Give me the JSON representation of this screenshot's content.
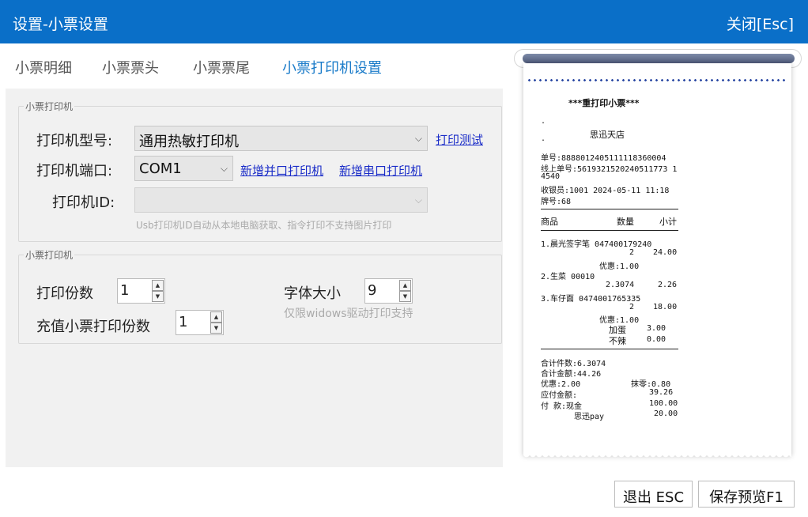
{
  "window": {
    "title": "设置-小票设置",
    "close_label": "关闭[Esc]"
  },
  "colors": {
    "titlebar": "#0a6fc8",
    "active_tab": "#1a7bc9",
    "link": "#1a2cc8"
  },
  "tabs": [
    {
      "label": "小票明细",
      "active": false
    },
    {
      "label": "小票票头",
      "active": false
    },
    {
      "label": "小票票尾",
      "active": false
    },
    {
      "label": "小票打印机设置",
      "active": true
    }
  ],
  "printer_group": {
    "legend": "小票打印机",
    "model_label": "打印机型号:",
    "model_value": "通用热敏打印机",
    "test_link": "打印测试",
    "port_label": "打印机端口:",
    "port_value": "COM1",
    "add_parallel_link": "新增并口打印机",
    "add_serial_link": "新增串口打印机",
    "id_label": "打印机ID:",
    "id_value": "",
    "id_hint": "Usb打印机ID自动从本地电脑获取、指令打印不支持图片打印"
  },
  "copies_group": {
    "legend": "小票打印机",
    "copies_label": "打印份数",
    "copies_value": "1",
    "font_size_label": "字体大小",
    "font_size_value": "9",
    "font_hint": "仅限widows驱动打印支持",
    "recharge_label": "充值小票打印份数",
    "recharge_value": "1"
  },
  "receipt": {
    "header": "***重打印小票***",
    "dot1": ".",
    "dot2": ".",
    "store": "思迅天店",
    "order_no": "单号:8888012405111118360004",
    "online_no_1": "线上单号:5619321520240511773 1",
    "online_no_2": "4540",
    "cashier": "收银员:1001 2024-05-11 11:18",
    "plate": "牌号:68",
    "col_item": "商品",
    "col_qty": "数量",
    "col_subtotal": "小计",
    "items": [
      {
        "name": "1.晨光签字笔 047400179240",
        "qty": "2",
        "amount": "24.00",
        "discount": "优惠:1.00"
      },
      {
        "name": "2.生菜 00010",
        "qty": "2.3074",
        "amount": "2.26"
      },
      {
        "name": "3.车仔面 0474001765335",
        "qty": "2",
        "amount": "18.00",
        "discount": "优惠:1.00",
        "addons": [
          {
            "name": "加蛋",
            "amount": "3.00"
          },
          {
            "name": "不辣",
            "amount": "0.00"
          }
        ]
      }
    ],
    "total_count": "合计件数:6.3074",
    "total_amount": "合计金额:44.26",
    "discount": "优惠:2.00",
    "round_off": "抹零:0.80",
    "payable_label": "应付金额:",
    "payable_value": "39.26",
    "pay_label": "付  款:现金",
    "pay_value": "100.00",
    "pay2_label": "思迅pay",
    "pay2_value": "20.00"
  },
  "footer": {
    "exit_label": "退出 ESC",
    "save_label": "保存预览F1"
  }
}
